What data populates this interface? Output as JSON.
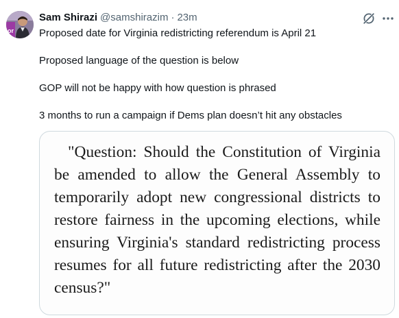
{
  "author": {
    "display_name": "Sam Shirazi",
    "handle": "@samshirazim",
    "separator": "·",
    "time": "23m",
    "avatar_icon": "avatar-photo",
    "avatar_badge_text": "or"
  },
  "actions": {
    "grok_icon": "grok-icon",
    "more_icon": "more-horizontal-icon"
  },
  "tweet": {
    "lines": [
      "Proposed date for Virginia redistricting referendum is April 21",
      "Proposed language of the question is below",
      "GOP will not be happy with how question is phrased",
      "3 months to run a campaign if Dems plan doesn’t hit any obstacles"
    ]
  },
  "media": {
    "quote_text": "\"Question: Should the Constitution of Virginia be amended to allow the General Assembly to temporarily adopt new congressional districts to restore fairness in the upcoming elections, while ensuring Virginia's standard redistricting process resumes for all future redistricting after the 2030 census?\""
  },
  "colors": {
    "text_primary": "#0f1419",
    "text_secondary": "#536471",
    "border": "#cfd9de"
  }
}
